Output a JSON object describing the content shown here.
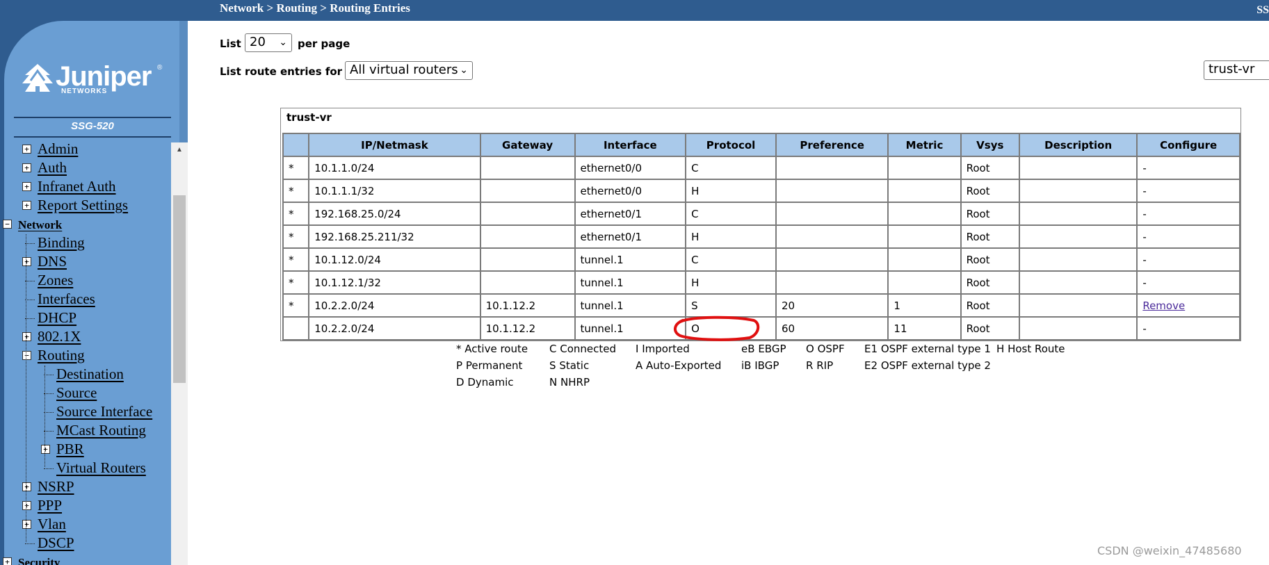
{
  "header": {
    "breadcrumb": "Network > Routing > Routing Entries",
    "device_tag": "SS"
  },
  "sidebar": {
    "logo_text": "Juniper",
    "logo_sub": "NETWORKS",
    "logo_reg": "®",
    "model": "SSG-520",
    "items": [
      {
        "label": "Admin",
        "level": 1,
        "expander": "+"
      },
      {
        "label": "Auth",
        "level": 1,
        "expander": "+"
      },
      {
        "label": "Infranet Auth",
        "level": 1,
        "expander": "+"
      },
      {
        "label": "Report Settings",
        "level": 1,
        "expander": "+"
      },
      {
        "label": "Network",
        "level": 0,
        "expander": "−"
      },
      {
        "label": "Binding",
        "level": 1,
        "expander": ""
      },
      {
        "label": "DNS",
        "level": 1,
        "expander": "+"
      },
      {
        "label": "Zones",
        "level": 1,
        "expander": ""
      },
      {
        "label": "Interfaces",
        "level": 1,
        "expander": ""
      },
      {
        "label": "DHCP",
        "level": 1,
        "expander": ""
      },
      {
        "label": "802.1X",
        "level": 1,
        "expander": "+"
      },
      {
        "label": "Routing",
        "level": 1,
        "expander": "−"
      },
      {
        "label": "Destination",
        "level": 2,
        "expander": ""
      },
      {
        "label": "Source",
        "level": 2,
        "expander": ""
      },
      {
        "label": "Source Interface",
        "level": 2,
        "expander": ""
      },
      {
        "label": "MCast Routing",
        "level": 2,
        "expander": ""
      },
      {
        "label": "PBR",
        "level": 2,
        "expander": "+"
      },
      {
        "label": "Virtual Routers",
        "level": 2,
        "expander": ""
      },
      {
        "label": "NSRP",
        "level": 1,
        "expander": "+"
      },
      {
        "label": "PPP",
        "level": 1,
        "expander": "+"
      },
      {
        "label": "Vlan",
        "level": 1,
        "expander": "+"
      },
      {
        "label": "DSCP",
        "level": 1,
        "expander": ""
      },
      {
        "label": "Security",
        "level": 0,
        "expander": "+"
      }
    ]
  },
  "controls": {
    "list_label": "List",
    "list_value": "20",
    "per_page_label": "per page",
    "route_for_label": "List route entries for",
    "route_for_value": "All virtual routers",
    "vr_value": "trust-vr"
  },
  "table": {
    "title": "trust-vr",
    "columns": [
      "",
      "IP/Netmask",
      "Gateway",
      "Interface",
      "Protocol",
      "Preference",
      "Metric",
      "Vsys",
      "Description",
      "Configure"
    ],
    "rows": [
      [
        "*",
        "10.1.1.0/24",
        "",
        "ethernet0/0",
        "C",
        "",
        "",
        "Root",
        "",
        "-"
      ],
      [
        "*",
        "10.1.1.1/32",
        "",
        "ethernet0/0",
        "H",
        "",
        "",
        "Root",
        "",
        "-"
      ],
      [
        "*",
        "192.168.25.0/24",
        "",
        "ethernet0/1",
        "C",
        "",
        "",
        "Root",
        "",
        "-"
      ],
      [
        "*",
        "192.168.25.211/32",
        "",
        "ethernet0/1",
        "H",
        "",
        "",
        "Root",
        "",
        "-"
      ],
      [
        "*",
        "10.1.12.0/24",
        "",
        "tunnel.1",
        "C",
        "",
        "",
        "Root",
        "",
        "-"
      ],
      [
        "*",
        "10.1.12.1/32",
        "",
        "tunnel.1",
        "H",
        "",
        "",
        "Root",
        "",
        "-"
      ],
      [
        "*",
        "10.2.2.0/24",
        "10.1.12.2",
        "tunnel.1",
        "S",
        "20",
        "1",
        "Root",
        "",
        "Remove"
      ],
      [
        "",
        "10.2.2.0/24",
        "10.1.12.2",
        "tunnel.1",
        "O",
        "60",
        "11",
        "Root",
        "",
        "-"
      ]
    ]
  },
  "legend": [
    {
      "code": "*",
      "text": "Active route"
    },
    {
      "code": "C",
      "text": "Connected"
    },
    {
      "code": "I",
      "text": "Imported"
    },
    {
      "code": "eB",
      "text": "EBGP"
    },
    {
      "code": "O",
      "text": "OSPF"
    },
    {
      "code": "E1",
      "text": "OSPF external type 1"
    },
    {
      "code": "H",
      "text": "Host Route"
    },
    {
      "code": "P",
      "text": "Permanent"
    },
    {
      "code": "S",
      "text": "Static"
    },
    {
      "code": "A",
      "text": "Auto-Exported"
    },
    {
      "code": "iB",
      "text": "IBGP"
    },
    {
      "code": "R",
      "text": "RIP"
    },
    {
      "code": "E2",
      "text": "OSPF external type 2"
    },
    {
      "code": "D",
      "text": "Dynamic"
    },
    {
      "code": "N",
      "text": "NHRP"
    }
  ],
  "watermark": "CSDN @weixin_47485680",
  "colors": {
    "header_bg": "#2f5c8f",
    "sidebar_bg": "#6a9ed3",
    "table_header_bg": "#a9c9ea",
    "annotation_red": "#e01010",
    "link": "#4a2a9a"
  }
}
